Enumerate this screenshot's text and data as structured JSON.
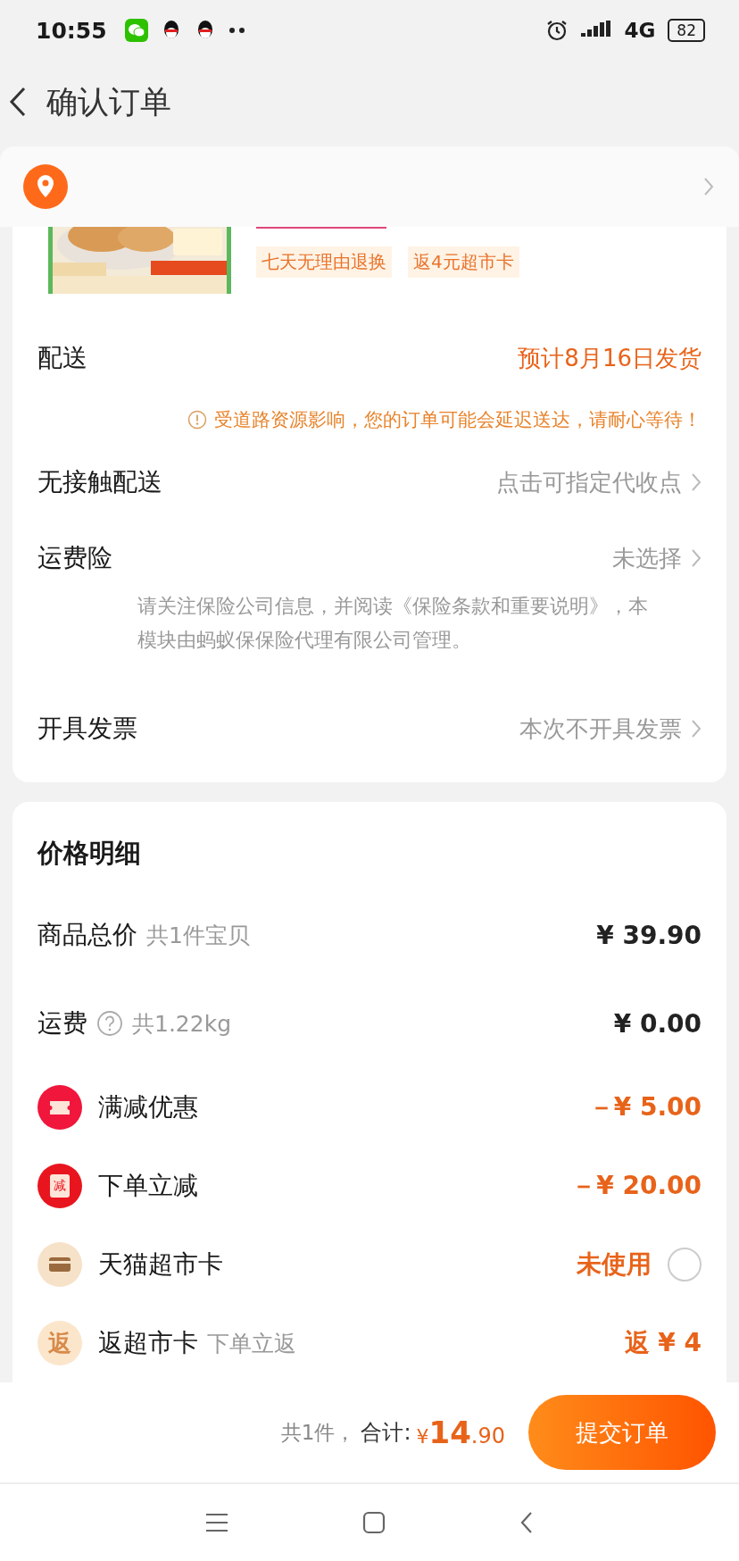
{
  "status_bar": {
    "time": "10:55",
    "network": "4G",
    "battery": "82"
  },
  "header": {
    "title": "确认订单"
  },
  "product": {
    "image": {
      "kind": "picture"
    },
    "tags": [
      "七天无理由退换",
      "返4元超市卡"
    ]
  },
  "delivery": {
    "label": "配送",
    "value": "预计8月16日发货",
    "notice": "受道路资源影响，您的订单可能会延迟送达，请耐心等待！"
  },
  "options": [
    {
      "label": "无接触配送",
      "value": "点击可指定代收点"
    },
    {
      "label": "运费险",
      "value": "未选择",
      "note": "请关注保险公司信息，并阅读《保险条款和重要说明》，本模块由蚂蚁保保险代理有限公司管理。"
    },
    {
      "label": "开具发票",
      "value": "本次不开具发票"
    }
  ],
  "price_details": {
    "title": "价格明细",
    "rows": [
      {
        "kind": "plain",
        "label": "商品总价",
        "sub": "共1件宝贝",
        "value": "¥ 39.90",
        "accent": false
      },
      {
        "kind": "help",
        "label": "运费",
        "sub": "共1.22kg",
        "value": "¥ 0.00",
        "accent": false
      },
      {
        "kind": "ticket",
        "label": "满减优惠",
        "value": "－¥ 5.00",
        "accent": true
      },
      {
        "kind": "badge",
        "icon_text": "减",
        "label": "下单立减",
        "value": "－¥ 20.00",
        "accent": true
      },
      {
        "kind": "card",
        "label": "天猫超市卡",
        "value": "未使用",
        "accent": true,
        "checked": false
      },
      {
        "kind": "rebate",
        "icon_text": "返",
        "label": "返超市卡",
        "sub": "下单立返",
        "value": "返 ¥ 4",
        "accent": true
      }
    ]
  },
  "footer": {
    "count": "共1件，",
    "total_label": "合计:",
    "currency": "¥",
    "total_int": "14",
    "total_dec": ".90",
    "submit": "提交订单"
  }
}
